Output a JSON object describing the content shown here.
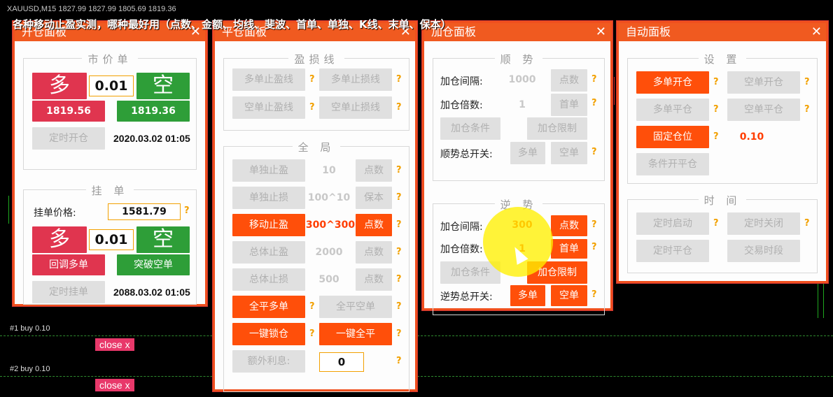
{
  "chart": {
    "info": "XAUUSD,M15  1827.99 1827.99 1805.69 1819.36",
    "orders": [
      {
        "label": "#1 buy 0.10",
        "close": "close x"
      },
      {
        "label": "#2 buy 0.10",
        "close": "close x"
      }
    ]
  },
  "overlay_title": "各种移动止盈实测，哪种最好用（点数、金额、均线、斐波、首单、单独、K线、末单、保本）",
  "open_panel": {
    "title": "开仓面板",
    "close": "✕",
    "market_group": "市价单",
    "buy": "多",
    "sell": "空",
    "lot": "0.01",
    "buy_price": "1819.56",
    "sell_price": "1819.36",
    "timed_open": "定时开仓",
    "timed_open_date": "2020.03.02 01:05",
    "pending_group": "挂 单",
    "pending_price_label": "挂单价格:",
    "pending_price": "1581.79",
    "q": "?",
    "pending_buy": "多",
    "pending_sell": "空",
    "pending_lot": "0.01",
    "pullback_buy": "回调多单",
    "breakout_sell": "突破空单",
    "timed_pending": "定时挂单",
    "timed_pending_date": "2088.03.02 01:05"
  },
  "close_panel": {
    "title": "平仓面板",
    "close": "✕",
    "sltp_group": "盈损线",
    "buy_tp_line": "多单止盈线",
    "buy_sl_line": "多单止损线",
    "sell_tp_line": "空单止盈线",
    "sell_sl_line": "空单止损线",
    "global_group": "全 局",
    "single_tp": "单独止盈",
    "single_tp_val": "10",
    "single_tp_mode": "点数",
    "single_sl": "单独止损",
    "single_sl_val": "100^10",
    "single_sl_mode": "保本",
    "trailing_tp": "移动止盈",
    "trailing_tp_val": "300^300",
    "trailing_tp_mode": "点数",
    "total_tp": "总体止盈",
    "total_tp_val": "2000",
    "total_tp_mode": "点数",
    "total_sl": "总体止损",
    "total_sl_val": "500",
    "total_sl_mode": "点数",
    "close_all_buy": "全平多单",
    "close_all_sell": "全平空单",
    "one_click_lock": "一键锁仓",
    "one_click_close": "一键全平",
    "extra_interest": "额外利息:",
    "extra_interest_val": "0",
    "q": "?"
  },
  "add_panel": {
    "title": "加仓面板",
    "close": "✕",
    "trend_group": "顺 势",
    "interval_label": "加仓间隔:",
    "interval_val": "1000",
    "interval_mode": "点数",
    "multiple_label": "加仓倍数:",
    "multiple_val": "1",
    "multiple_mode": "首单",
    "add_cond": "加仓条件",
    "add_limit": "加仓限制",
    "trend_switch_label": "顺势总开关:",
    "buy": "多单",
    "sell": "空单",
    "counter_group": "逆 势",
    "c_interval_label": "加仓间隔:",
    "c_interval_val": "300",
    "c_interval_mode": "点数",
    "c_multiple_label": "加仓倍数:",
    "c_multiple_val": "1",
    "c_multiple_mode": "首单",
    "c_add_cond": "加仓条件",
    "c_add_limit": "加仓限制",
    "c_switch_label": "逆势总开关:",
    "c_buy": "多单",
    "c_sell": "空单",
    "q": "?"
  },
  "auto_panel": {
    "title": "自动面板",
    "close": "✕",
    "settings_group": "设 置",
    "buy_open": "多单开仓",
    "sell_open": "空单开仓",
    "buy_close": "多单平仓",
    "sell_close": "空单平仓",
    "fixed_lot": "固定仓位",
    "fixed_lot_val": "0.10",
    "cond_close": "条件开平仓",
    "time_group": "时 间",
    "timed_start": "定时启动",
    "timed_stop": "定时关闭",
    "timed_close": "定时平仓",
    "trading_hours": "交易时段",
    "q": "?"
  },
  "colors": {
    "accent": "#f05a20",
    "buy_red": "#e0354f",
    "sell_green": "#2e9e38",
    "help": "#f2a000"
  }
}
